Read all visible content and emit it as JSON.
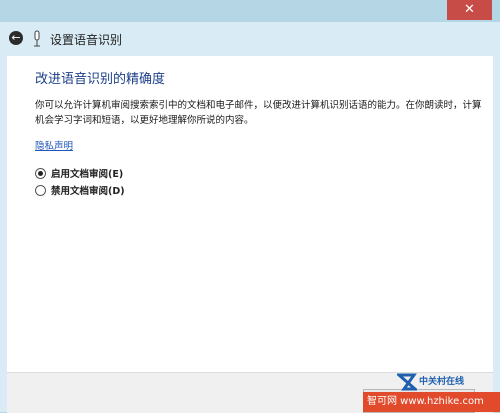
{
  "window": {
    "title": "设置语音识别",
    "close_glyph": "✕"
  },
  "page": {
    "heading": "改进语音识别的精确度",
    "description": "你可以允许计算机审阅搜索索引中的文档和电子邮件，以便改进计算机识别话语的能力。在你朗读时，计算机会学习字词和短语，以更好地理解你所说的内容。",
    "privacy_link": "隐私声明"
  },
  "options": [
    {
      "label": "启用文档审阅(E)",
      "checked": true
    },
    {
      "label": "禁用文档审阅(D)",
      "checked": false
    }
  ],
  "watermark": {
    "brand": "中关村在线",
    "site": "智可网 www.hzhike.com"
  },
  "colors": {
    "chrome": "#b5d6e5",
    "close": "#c74b47",
    "heading": "#1c3f8a",
    "link": "#1f55b5"
  }
}
